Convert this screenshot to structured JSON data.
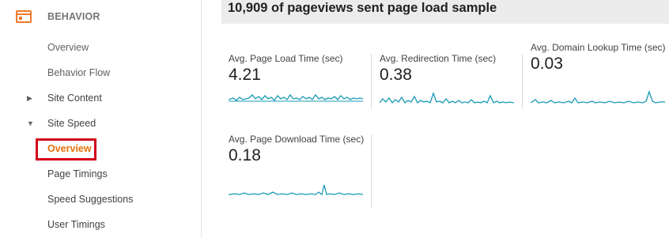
{
  "sidebar": {
    "section_label": "BEHAVIOR",
    "items": [
      {
        "label": "Overview"
      },
      {
        "label": "Behavior Flow"
      },
      {
        "label": "Site Content"
      },
      {
        "label": "Site Speed"
      },
      {
        "label": "Overview"
      },
      {
        "label": "Page Timings"
      },
      {
        "label": "Speed Suggestions"
      },
      {
        "label": "User Timings"
      }
    ]
  },
  "header": {
    "title": "10,909 of pageviews sent page load sample"
  },
  "metrics": [
    {
      "label": "Avg. Page Load Time (sec)",
      "value": "4.21"
    },
    {
      "label": "Avg. Redirection Time (sec)",
      "value": "0.38"
    },
    {
      "label": "Avg. Domain Lookup Time (sec)",
      "value": "0.03"
    },
    {
      "label": "Avg. Page Download Time (sec)",
      "value": "0.18"
    }
  ],
  "colors": {
    "accent": "#e8710a",
    "sparkline": "#1a9ab5",
    "highlight_border": "#d0021b"
  }
}
